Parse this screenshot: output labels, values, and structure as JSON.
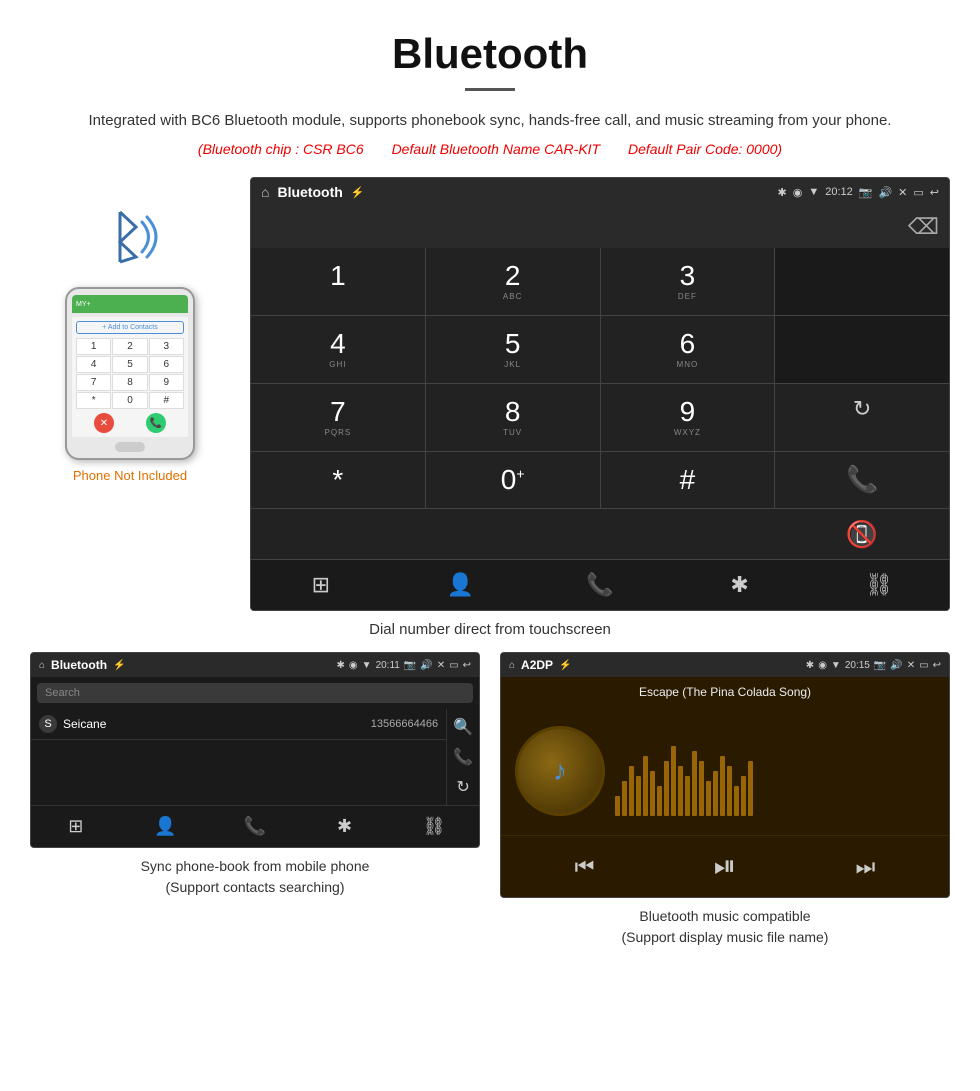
{
  "header": {
    "title": "Bluetooth",
    "description": "Integrated with BC6 Bluetooth module, supports phonebook sync, hands-free call, and music streaming from your phone.",
    "specs": "(Bluetooth chip : CSR BC6    Default Bluetooth Name CAR-KIT    Default Pair Code: 0000)",
    "spec_chip": "(Bluetooth chip : CSR BC6",
    "spec_name": "Default Bluetooth Name CAR-KIT",
    "spec_code": "Default Pair Code: 0000)"
  },
  "phone_side": {
    "not_included": "Phone Not Included",
    "add_to_contacts": "+ Add to Contacts",
    "keys": [
      "1",
      "2",
      "3",
      "4",
      "5",
      "6",
      "7",
      "8",
      "9",
      "*",
      "0",
      "#"
    ]
  },
  "main_screen": {
    "status_bar": {
      "title": "Bluetooth",
      "time": "20:12",
      "usb_icon": "⚡",
      "home_icon": "⌂"
    },
    "keypad": [
      {
        "main": "1",
        "sub": ""
      },
      {
        "main": "2",
        "sub": "ABC"
      },
      {
        "main": "3",
        "sub": "DEF"
      },
      {
        "main": "",
        "sub": "",
        "type": "empty"
      },
      {
        "main": "4",
        "sub": "GHI"
      },
      {
        "main": "5",
        "sub": "JKL"
      },
      {
        "main": "6",
        "sub": "MNO"
      },
      {
        "main": "",
        "sub": "",
        "type": "empty"
      },
      {
        "main": "7",
        "sub": "PQRS"
      },
      {
        "main": "8",
        "sub": "TUV"
      },
      {
        "main": "9",
        "sub": "WXYZ"
      },
      {
        "main": "↻",
        "sub": "",
        "type": "reload"
      },
      {
        "main": "*",
        "sub": ""
      },
      {
        "main": "0",
        "sub": "+"
      },
      {
        "main": "#",
        "sub": ""
      },
      {
        "main": "📞",
        "sub": "",
        "type": "call"
      },
      {
        "main": "📵",
        "sub": "",
        "type": "hangup"
      }
    ],
    "bottom_icons": [
      "⊞",
      "👤",
      "📞",
      "✱",
      "⛓"
    ]
  },
  "caption_main": "Dial number direct from touchscreen",
  "phonebook_screen": {
    "status": {
      "title": "Bluetooth",
      "time": "20:11"
    },
    "search_placeholder": "Search",
    "contacts": [
      {
        "letter": "S",
        "name": "Seicane",
        "number": "13566664466"
      }
    ],
    "right_icons": [
      "🔍",
      "📞",
      "↻"
    ],
    "bottom_icons": [
      "⊞",
      "👤",
      "📞",
      "✱",
      "⛓"
    ]
  },
  "caption_phonebook": "Sync phone-book from mobile phone\n(Support contacts searching)",
  "music_screen": {
    "status": {
      "title": "A2DP",
      "time": "20:15"
    },
    "song_title": "Escape (The Pina Colada Song)",
    "controls": [
      "⏮",
      "⏯",
      "⏭"
    ],
    "wave_heights": [
      20,
      35,
      50,
      40,
      60,
      45,
      30,
      55,
      70,
      50,
      40,
      65,
      55,
      35,
      45,
      60,
      50,
      30,
      40,
      55
    ]
  },
  "caption_music": "Bluetooth music compatible\n(Support display music file name)"
}
